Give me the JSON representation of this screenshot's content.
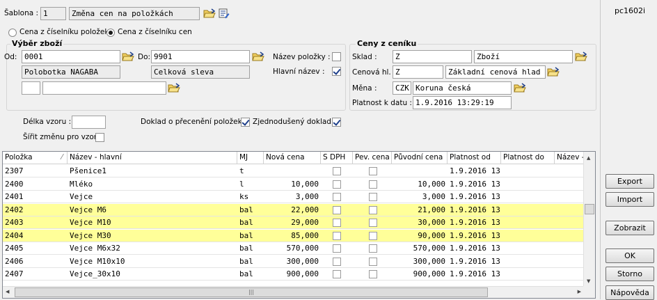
{
  "top": {
    "sablona_label": "Šablona :",
    "sablona_num": "1",
    "sablona_name": "Změna cen na položkách",
    "form_id": "pc1602i"
  },
  "radios": [
    {
      "label": "Cena z číselníku položek",
      "selected": false
    },
    {
      "label": "Cena z číselníku cen",
      "selected": true
    }
  ],
  "vyber": {
    "title": "Výběr zboží",
    "od_label": "Od:",
    "od_value": "0001",
    "od_name": "Polobotka NAGABA",
    "do_label": "Do:",
    "do_value": "9901",
    "do_name": "Celková sleva",
    "nazev_polozky_label": "Název položky :",
    "nazev_polozky_checked": false,
    "hlavni_nazev_label": "Hlavní název :",
    "hlavni_nazev_checked": true,
    "extra_code": "",
    "extra_name": ""
  },
  "ceny": {
    "title": "Ceny z ceníku",
    "sklad_label": "Sklad :",
    "sklad_code": "Z",
    "sklad_name": "Zboží",
    "cenova_label": "Cenová hl. :",
    "cenova_code": "Z",
    "cenova_name": "Základní cenová hlad",
    "mena_label": "Měna :",
    "mena_code": "CZK",
    "mena_name": "Koruna česká",
    "platnost_label": "Platnost k datu :",
    "platnost_value": "1.9.2016 13:29:19"
  },
  "options": {
    "delka_label": "Délka vzoru :",
    "delka_value": "",
    "sirit_label": "Šířit změnu pro vzor",
    "sirit_checked": false,
    "doklad_label": "Doklad o přecenění položek :",
    "doklad_checked": true,
    "zjednoduseny_label": "Zjednodušený doklad :",
    "zjednoduseny_checked": true
  },
  "grid": {
    "columns": [
      "Položka",
      "Název - hlavní",
      "MJ",
      "Nová cena",
      "S DPH",
      "Pev. cena",
      "Původní cena",
      "Platnost od",
      "Platnost do",
      "Název -"
    ],
    "rows": [
      {
        "polozka": "2307",
        "nazev": "Pšenice1",
        "mj": "t",
        "nova": "",
        "puvodni": "",
        "od": "1.9.2016 13",
        "hl": false
      },
      {
        "polozka": "2400",
        "nazev": "Mléko",
        "mj": "l",
        "nova": "10,000",
        "puvodni": "10,000",
        "od": "1.9.2016 13",
        "hl": false
      },
      {
        "polozka": "2401",
        "nazev": "Vejce",
        "mj": "ks",
        "nova": "3,000",
        "puvodni": "3,000",
        "od": "1.9.2016 13",
        "hl": false
      },
      {
        "polozka": "2402",
        "nazev": "Vejce M6",
        "mj": "bal",
        "nova": "22,000",
        "puvodni": "21,000",
        "od": "1.9.2016 13",
        "hl": true
      },
      {
        "polozka": "2403",
        "nazev": "Vejce M10",
        "mj": "bal",
        "nova": "29,000",
        "puvodni": "30,000",
        "od": "1.9.2016 13",
        "hl": true
      },
      {
        "polozka": "2404",
        "nazev": "Vejce M30",
        "mj": "bal",
        "nova": "85,000",
        "puvodni": "90,000",
        "od": "1.9.2016 13",
        "hl": true
      },
      {
        "polozka": "2405",
        "nazev": "Vejce M6x32",
        "mj": "bal",
        "nova": "570,000",
        "puvodni": "570,000",
        "od": "1.9.2016 13",
        "hl": false
      },
      {
        "polozka": "2406",
        "nazev": "Vejce M10x10",
        "mj": "bal",
        "nova": "300,000",
        "puvodni": "300,000",
        "od": "1.9.2016 13",
        "hl": false
      },
      {
        "polozka": "2407",
        "nazev": "Vejce_30x10",
        "mj": "bal",
        "nova": "900,000",
        "puvodni": "900,000",
        "od": "1.9.2016 13",
        "hl": false
      }
    ]
  },
  "buttons": {
    "export": "Export",
    "import": "Import",
    "zobrazit": "Zobrazit",
    "ok": "OK",
    "storno": "Storno",
    "napoveda": "Nápověda"
  },
  "colors": {
    "highlight_row": "#ffff99",
    "folder": "#e8c040",
    "accent_blue": "#1e3f8a"
  }
}
